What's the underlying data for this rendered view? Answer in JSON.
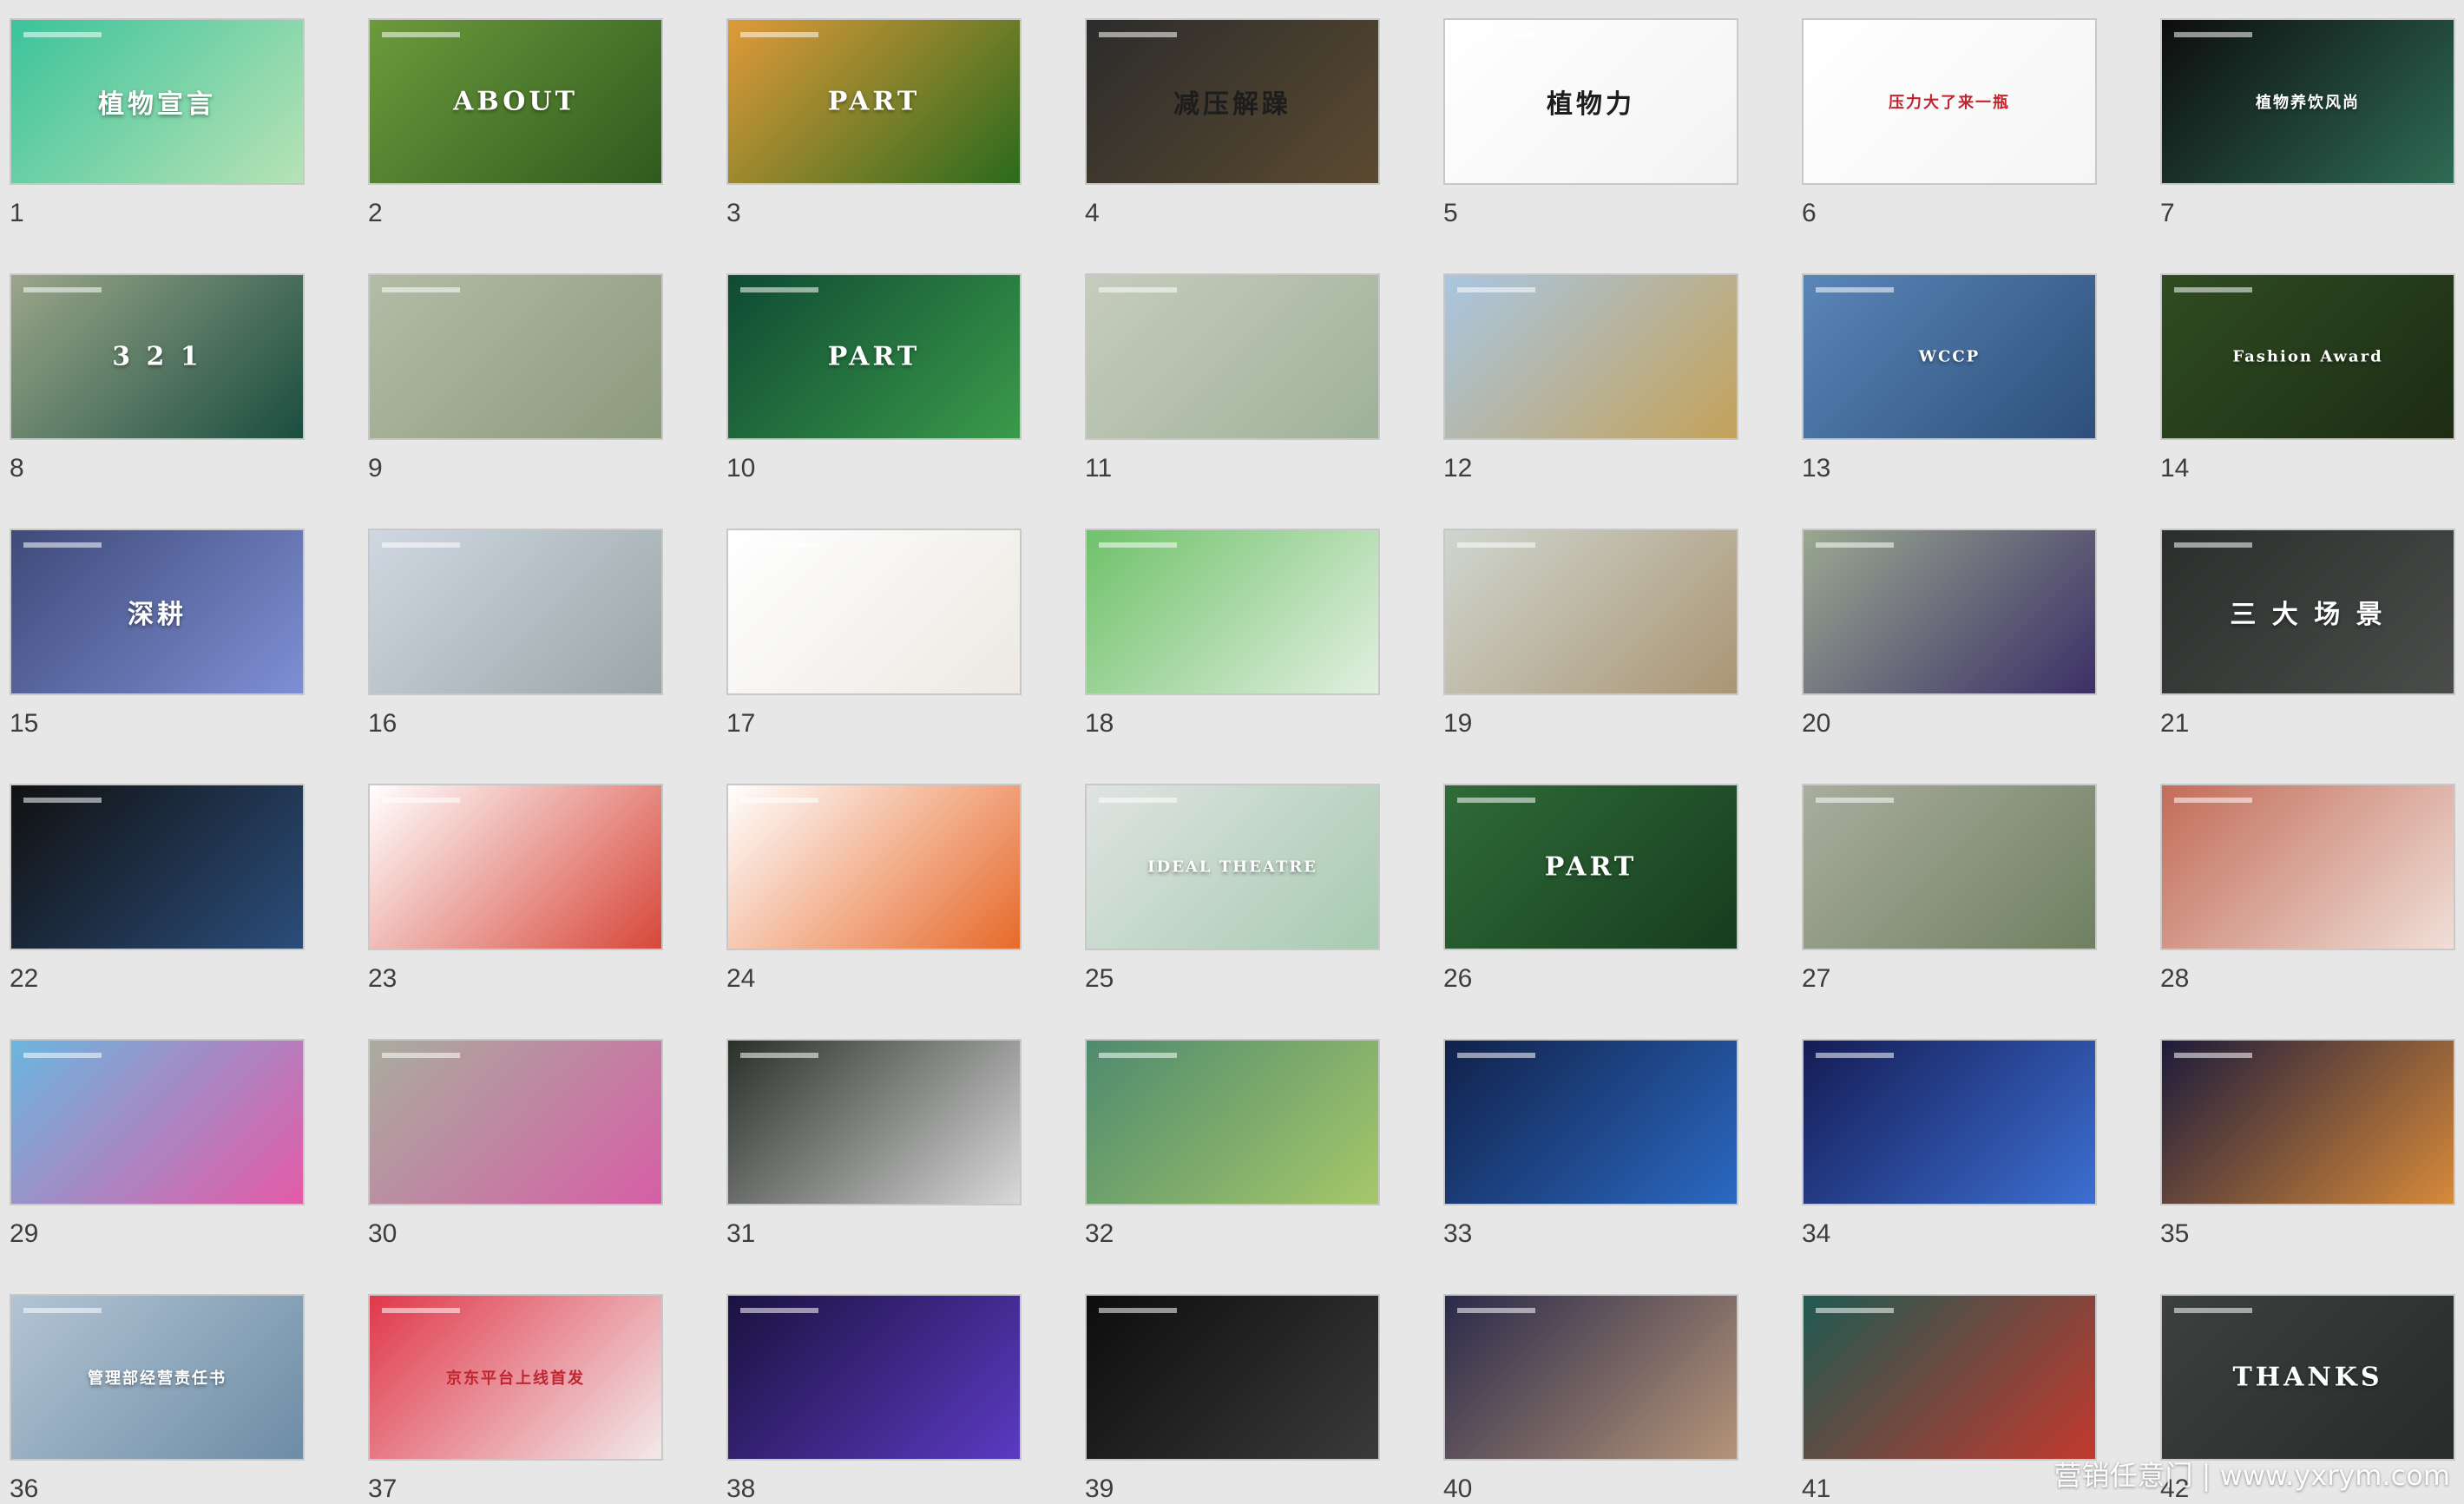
{
  "watermark": "营销任意门 | www.yxrym.com",
  "slides": [
    {
      "number": "1",
      "title": "植物宣言",
      "colors": [
        "#3cc39b",
        "#b7e3b5"
      ]
    },
    {
      "number": "2",
      "title": "ABOUT",
      "colors": [
        "#6d9a3c",
        "#2f5a1e"
      ]
    },
    {
      "number": "3",
      "title": "PART",
      "colors": [
        "#e09a3a",
        "#2a6a1c"
      ]
    },
    {
      "number": "4",
      "title": "减压解躁",
      "colors": [
        "#2c2c2c",
        "#5b4a30"
      ]
    },
    {
      "number": "5",
      "title": "植物力",
      "colors": [
        "#ffffff",
        "#f3f3f3"
      ]
    },
    {
      "number": "6",
      "title": "压力大了来一瓶",
      "colors": [
        "#ffffff",
        "#f5f5f5"
      ]
    },
    {
      "number": "7",
      "title": "植物养饮风尚",
      "colors": [
        "#0d0d0d",
        "#2e6b55"
      ]
    },
    {
      "number": "8",
      "title": "3 2 1",
      "colors": [
        "#9aa68a",
        "#1a4d3f"
      ]
    },
    {
      "number": "9",
      "title": "",
      "colors": [
        "#b3bca6",
        "#8c9a7d"
      ]
    },
    {
      "number": "10",
      "title": "PART",
      "colors": [
        "#0f4a33",
        "#3a9a4a"
      ]
    },
    {
      "number": "11",
      "title": "",
      "colors": [
        "#c6ccbd",
        "#9fb19a"
      ]
    },
    {
      "number": "12",
      "title": "",
      "colors": [
        "#a9c6e2",
        "#c4a25a"
      ]
    },
    {
      "number": "13",
      "title": "WCCP",
      "colors": [
        "#5a86b8",
        "#2d4f7a"
      ]
    },
    {
      "number": "14",
      "title": "Fashion Award",
      "colors": [
        "#2f4c22",
        "#1d2c14"
      ]
    },
    {
      "number": "15",
      "title": "深耕",
      "colors": [
        "#3f4a7a",
        "#7e8fd4"
      ]
    },
    {
      "number": "16",
      "title": "",
      "colors": [
        "#cfd8e2",
        "#9aa6a8"
      ]
    },
    {
      "number": "17",
      "title": "",
      "colors": [
        "#ffffff",
        "#ece9e2"
      ]
    },
    {
      "number": "18",
      "title": "",
      "colors": [
        "#6fc26a",
        "#e2efe0"
      ]
    },
    {
      "number": "19",
      "title": "",
      "colors": [
        "#cfd6cf",
        "#aa9574"
      ]
    },
    {
      "number": "20",
      "title": "",
      "colors": [
        "#9aa890",
        "#3b2f66"
      ]
    },
    {
      "number": "21",
      "title": "三 大 场 景",
      "colors": [
        "#2a2f2c",
        "#4a4d4a"
      ]
    },
    {
      "number": "22",
      "title": "",
      "colors": [
        "#111111",
        "#2b4d7a"
      ]
    },
    {
      "number": "23",
      "title": "",
      "colors": [
        "#ffffff",
        "#d7473a"
      ]
    },
    {
      "number": "24",
      "title": "",
      "colors": [
        "#ffffff",
        "#e76a2a"
      ]
    },
    {
      "number": "25",
      "title": "IDEAL THEATRE",
      "colors": [
        "#dfe3e2",
        "#a7cbb0"
      ]
    },
    {
      "number": "26",
      "title": "PART",
      "colors": [
        "#2f6b38",
        "#173d1f"
      ]
    },
    {
      "number": "27",
      "title": "",
      "colors": [
        "#a9ad9e",
        "#6f8061"
      ]
    },
    {
      "number": "28",
      "title": "",
      "colors": [
        "#c26c58",
        "#f0dfd8"
      ]
    },
    {
      "number": "29",
      "title": "",
      "colors": [
        "#6ab6df",
        "#e55aa7"
      ]
    },
    {
      "number": "30",
      "title": "",
      "colors": [
        "#a9ad9e",
        "#d65fa6"
      ]
    },
    {
      "number": "31",
      "title": "",
      "colors": [
        "#2a2f2a",
        "#d9d9d9"
      ]
    },
    {
      "number": "32",
      "title": "",
      "colors": [
        "#4e8a6e",
        "#a6c86a"
      ]
    },
    {
      "number": "33",
      "title": "",
      "colors": [
        "#11214a",
        "#2b69c2"
      ]
    },
    {
      "number": "34",
      "title": "",
      "colors": [
        "#151c55",
        "#3c6fd2"
      ]
    },
    {
      "number": "35",
      "title": "",
      "colors": [
        "#1d1b3a",
        "#d78a3a"
      ]
    },
    {
      "number": "36",
      "title": "管理部经营责任书",
      "colors": [
        "#b2c4d4",
        "#6d8ca5"
      ]
    },
    {
      "number": "37",
      "title": "京东平台上线首发",
      "colors": [
        "#e0384a",
        "#f2eaea"
      ]
    },
    {
      "number": "38",
      "title": "",
      "colors": [
        "#1b1240",
        "#5b3ac2"
      ]
    },
    {
      "number": "39",
      "title": "",
      "colors": [
        "#0d0d0d",
        "#3a3a3a"
      ]
    },
    {
      "number": "40",
      "title": "",
      "colors": [
        "#2a2a4a",
        "#b49478"
      ]
    },
    {
      "number": "41",
      "title": "",
      "colors": [
        "#1f5a52",
        "#c2392e"
      ]
    },
    {
      "number": "42",
      "title": "THANKS",
      "colors": [
        "#3c4140",
        "#272b2a"
      ]
    }
  ]
}
